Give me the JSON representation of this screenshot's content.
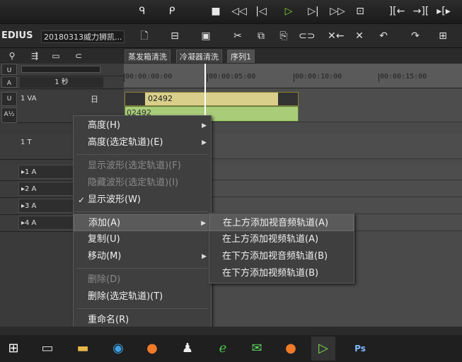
{
  "app": {
    "name": "EDIUS",
    "project": "20180313威力狮凯..."
  },
  "transport": {
    "icons": [
      "mark-in-icon",
      "mark-out-icon",
      "stop-icon",
      "rewind-icon",
      "step-back-icon",
      "play-icon",
      "step-forward-icon",
      "fast-forward-icon",
      "loop-icon"
    ]
  },
  "tabs": [
    {
      "label": "蒸发箱清洗"
    },
    {
      "label": "冷凝器清洗"
    },
    {
      "label": "序列1"
    }
  ],
  "timeline": {
    "scale_label": "1 秒",
    "ruler": [
      "00:00:00:00",
      "00:00:05:00",
      "00:00:10:00",
      "00:00:15:00"
    ]
  },
  "tracks": {
    "va": "1 VA",
    "va_flag": "日",
    "t": "1 T",
    "a1": "▸1 A",
    "a2": "▸2 A",
    "a3": "▸3 A",
    "a4": "▸4 A"
  },
  "clips": {
    "video": "02492",
    "audio": "02492"
  },
  "context_menu": {
    "items": [
      {
        "label": "高度(H)",
        "disabled": false,
        "submenu": true
      },
      {
        "label": "高度(选定轨道)(E)",
        "disabled": false,
        "submenu": true
      },
      {
        "label": "显示波形(选定轨道)(F)",
        "disabled": true
      },
      {
        "label": "隐藏波形(选定轨道)(I)",
        "disabled": true
      },
      {
        "label": "显示波形(W)",
        "disabled": false,
        "checked": true
      },
      {
        "label": "添加(A)",
        "disabled": false,
        "submenu": true
      },
      {
        "label": "复制(U)",
        "disabled": false
      },
      {
        "label": "移动(M)",
        "disabled": false,
        "submenu": true
      },
      {
        "label": "删除(D)",
        "disabled": true
      },
      {
        "label": "删除(选定轨道)(T)",
        "disabled": false
      },
      {
        "label": "重命名(R)",
        "disabled": false
      }
    ]
  },
  "submenu": {
    "items": [
      {
        "label": "在上方添加视音频轨道(A)"
      },
      {
        "label": "在上方添加视频轨道(A)"
      },
      {
        "label": "在下方添加视音频轨道(B)"
      },
      {
        "label": "在下方添加视频轨道(B)"
      }
    ]
  },
  "taskbar": {
    "icons": [
      "windows-start-icon",
      "task-view-icon",
      "file-explorer-icon",
      "browser-icon",
      "firefox-icon",
      "qq-icon",
      "ie-icon",
      "wechat-icon",
      "firefox-icon",
      "edius-icon",
      "photoshop-icon"
    ],
    "ps_label": "Ps"
  }
}
